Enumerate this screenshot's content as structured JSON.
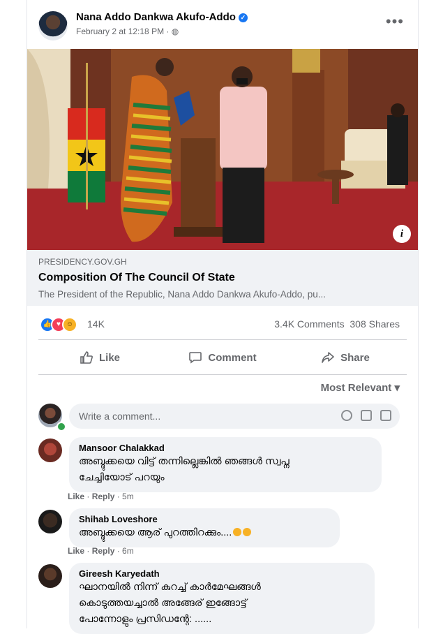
{
  "post": {
    "author": "Nana Addo Dankwa Akufo-Addo",
    "timestamp": "February 2 at 12:18 PM",
    "privacy_glyph": "·",
    "more_glyph": "•••"
  },
  "link_preview": {
    "domain": "PRESIDENCY.GOV.GH",
    "title": "Composition Of The Council Of State",
    "description": "The President of the Republic, Nana Addo Dankwa Akufo-Addo, pu..."
  },
  "stats": {
    "reactions_count": "14K",
    "comments": "3.4K Comments",
    "shares": "308 Shares"
  },
  "actions": {
    "like": "Like",
    "comment": "Comment",
    "share": "Share"
  },
  "sort": "Most Relevant",
  "comment_box": {
    "placeholder": "Write a comment..."
  },
  "comments": [
    {
      "name": "Mansoor Chalakkad",
      "line1": "അബ്ദുക്കയെ വിട്ട് തന്നില്ലെങ്കിൽ ഞങ്ങൾ സ്വപ്ന",
      "line2": "ചേച്ചിയോട് പറയും",
      "like": "Like",
      "reply": "Reply",
      "time": "5m"
    },
    {
      "name": "Shihab Loveshore",
      "line1": "അബ്ദുക്കയെ ആര് പുറത്തിറക്കും....",
      "line2": "",
      "like": "Like",
      "reply": "Reply",
      "time": "6m"
    },
    {
      "name": "Gireesh Karyedath",
      "line1": "ഘാനയിൽ നിന്ന് കുറച്ച് കാർമേഘങ്ങൾ",
      "line2": "കൊടുത്തയച്ചാൽ അങ്ങേര് ഇങ്ങോട്ട്",
      "line3": "പോന്നോളും പ്രസിഡന്റേ: ......",
      "like": "",
      "reply": "",
      "time": ""
    }
  ],
  "colors": {
    "brand": "#1877f2",
    "text": "#050505",
    "secondary": "#65676b",
    "bubble": "#f0f2f5"
  }
}
